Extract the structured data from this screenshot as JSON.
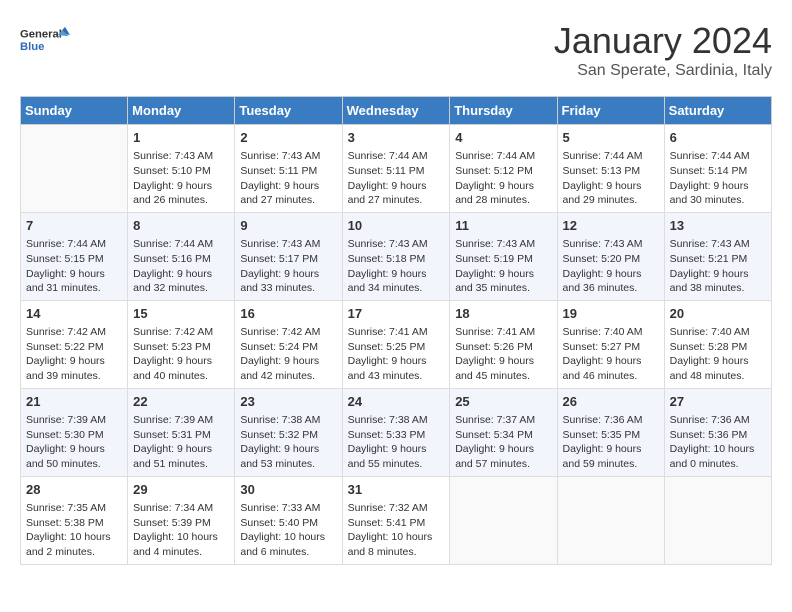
{
  "header": {
    "logo_line1": "General",
    "logo_line2": "Blue",
    "month": "January 2024",
    "location": "San Sperate, Sardinia, Italy"
  },
  "columns": [
    "Sunday",
    "Monday",
    "Tuesday",
    "Wednesday",
    "Thursday",
    "Friday",
    "Saturday"
  ],
  "weeks": [
    [
      {
        "day": "",
        "sunrise": "",
        "sunset": "",
        "daylight": ""
      },
      {
        "day": "1",
        "sunrise": "7:43 AM",
        "sunset": "5:10 PM",
        "daylight": "9 hours and 26 minutes."
      },
      {
        "day": "2",
        "sunrise": "7:43 AM",
        "sunset": "5:11 PM",
        "daylight": "9 hours and 27 minutes."
      },
      {
        "day": "3",
        "sunrise": "7:44 AM",
        "sunset": "5:11 PM",
        "daylight": "9 hours and 27 minutes."
      },
      {
        "day": "4",
        "sunrise": "7:44 AM",
        "sunset": "5:12 PM",
        "daylight": "9 hours and 28 minutes."
      },
      {
        "day": "5",
        "sunrise": "7:44 AM",
        "sunset": "5:13 PM",
        "daylight": "9 hours and 29 minutes."
      },
      {
        "day": "6",
        "sunrise": "7:44 AM",
        "sunset": "5:14 PM",
        "daylight": "9 hours and 30 minutes."
      }
    ],
    [
      {
        "day": "7",
        "sunrise": "7:44 AM",
        "sunset": "5:15 PM",
        "daylight": "9 hours and 31 minutes."
      },
      {
        "day": "8",
        "sunrise": "7:44 AM",
        "sunset": "5:16 PM",
        "daylight": "9 hours and 32 minutes."
      },
      {
        "day": "9",
        "sunrise": "7:43 AM",
        "sunset": "5:17 PM",
        "daylight": "9 hours and 33 minutes."
      },
      {
        "day": "10",
        "sunrise": "7:43 AM",
        "sunset": "5:18 PM",
        "daylight": "9 hours and 34 minutes."
      },
      {
        "day": "11",
        "sunrise": "7:43 AM",
        "sunset": "5:19 PM",
        "daylight": "9 hours and 35 minutes."
      },
      {
        "day": "12",
        "sunrise": "7:43 AM",
        "sunset": "5:20 PM",
        "daylight": "9 hours and 36 minutes."
      },
      {
        "day": "13",
        "sunrise": "7:43 AM",
        "sunset": "5:21 PM",
        "daylight": "9 hours and 38 minutes."
      }
    ],
    [
      {
        "day": "14",
        "sunrise": "7:42 AM",
        "sunset": "5:22 PM",
        "daylight": "9 hours and 39 minutes."
      },
      {
        "day": "15",
        "sunrise": "7:42 AM",
        "sunset": "5:23 PM",
        "daylight": "9 hours and 40 minutes."
      },
      {
        "day": "16",
        "sunrise": "7:42 AM",
        "sunset": "5:24 PM",
        "daylight": "9 hours and 42 minutes."
      },
      {
        "day": "17",
        "sunrise": "7:41 AM",
        "sunset": "5:25 PM",
        "daylight": "9 hours and 43 minutes."
      },
      {
        "day": "18",
        "sunrise": "7:41 AM",
        "sunset": "5:26 PM",
        "daylight": "9 hours and 45 minutes."
      },
      {
        "day": "19",
        "sunrise": "7:40 AM",
        "sunset": "5:27 PM",
        "daylight": "9 hours and 46 minutes."
      },
      {
        "day": "20",
        "sunrise": "7:40 AM",
        "sunset": "5:28 PM",
        "daylight": "9 hours and 48 minutes."
      }
    ],
    [
      {
        "day": "21",
        "sunrise": "7:39 AM",
        "sunset": "5:30 PM",
        "daylight": "9 hours and 50 minutes."
      },
      {
        "day": "22",
        "sunrise": "7:39 AM",
        "sunset": "5:31 PM",
        "daylight": "9 hours and 51 minutes."
      },
      {
        "day": "23",
        "sunrise": "7:38 AM",
        "sunset": "5:32 PM",
        "daylight": "9 hours and 53 minutes."
      },
      {
        "day": "24",
        "sunrise": "7:38 AM",
        "sunset": "5:33 PM",
        "daylight": "9 hours and 55 minutes."
      },
      {
        "day": "25",
        "sunrise": "7:37 AM",
        "sunset": "5:34 PM",
        "daylight": "9 hours and 57 minutes."
      },
      {
        "day": "26",
        "sunrise": "7:36 AM",
        "sunset": "5:35 PM",
        "daylight": "9 hours and 59 minutes."
      },
      {
        "day": "27",
        "sunrise": "7:36 AM",
        "sunset": "5:36 PM",
        "daylight": "10 hours and 0 minutes."
      }
    ],
    [
      {
        "day": "28",
        "sunrise": "7:35 AM",
        "sunset": "5:38 PM",
        "daylight": "10 hours and 2 minutes."
      },
      {
        "day": "29",
        "sunrise": "7:34 AM",
        "sunset": "5:39 PM",
        "daylight": "10 hours and 4 minutes."
      },
      {
        "day": "30",
        "sunrise": "7:33 AM",
        "sunset": "5:40 PM",
        "daylight": "10 hours and 6 minutes."
      },
      {
        "day": "31",
        "sunrise": "7:32 AM",
        "sunset": "5:41 PM",
        "daylight": "10 hours and 8 minutes."
      },
      {
        "day": "",
        "sunrise": "",
        "sunset": "",
        "daylight": ""
      },
      {
        "day": "",
        "sunrise": "",
        "sunset": "",
        "daylight": ""
      },
      {
        "day": "",
        "sunrise": "",
        "sunset": "",
        "daylight": ""
      }
    ]
  ]
}
